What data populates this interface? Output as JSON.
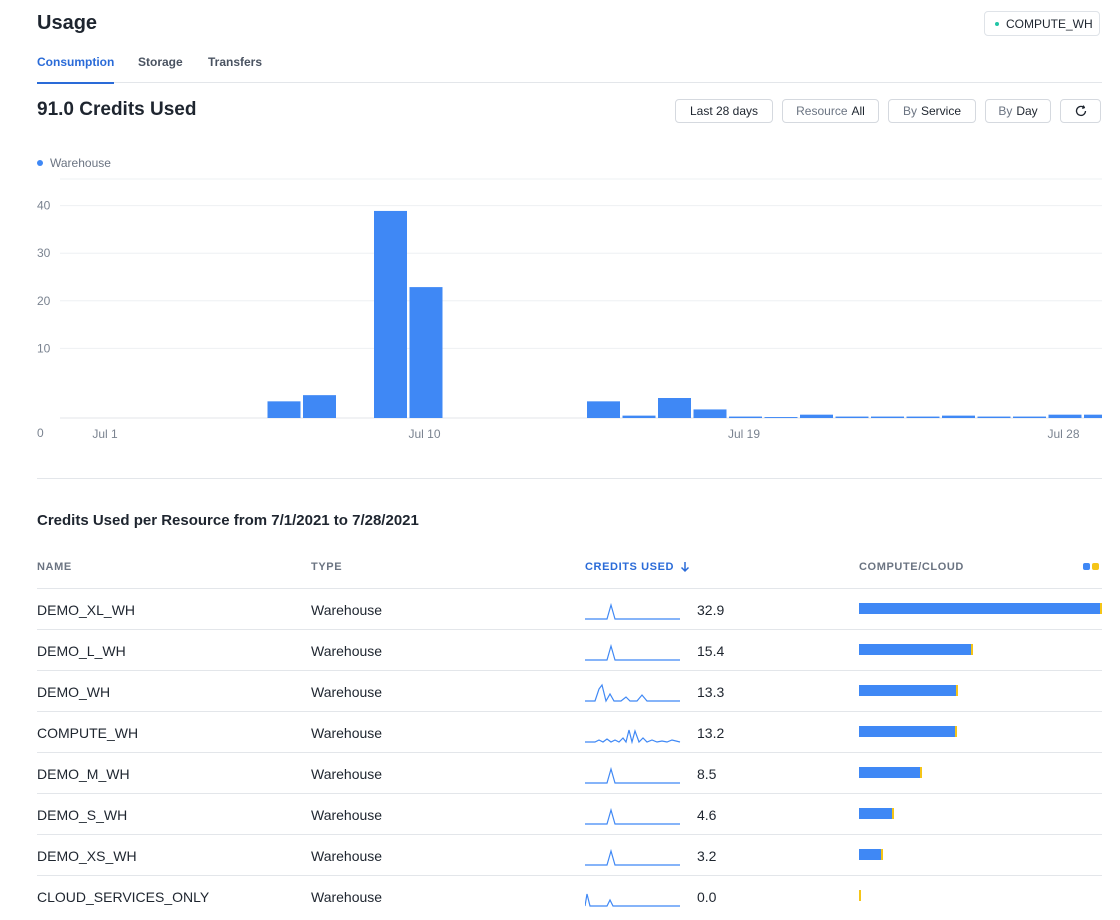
{
  "header": {
    "title": "Usage",
    "warehouse_badge": "COMPUTE_WH"
  },
  "tabs": [
    {
      "label": "Consumption",
      "active": true
    },
    {
      "label": "Storage",
      "active": false
    },
    {
      "label": "Transfers",
      "active": false
    }
  ],
  "summary": {
    "credits_title": "91.0 Credits Used"
  },
  "filters": {
    "date_range": "Last 28 days",
    "resource_label": "Resource",
    "resource_value": "All",
    "group_label": "By",
    "group_value": "Service",
    "interval_label": "By",
    "interval_value": "Day"
  },
  "colors": {
    "accent": "#2a6bd8",
    "bar": "#3f88f5",
    "cloud": "#f5c518",
    "badge_dot": "#22c5a6"
  },
  "chart_data": {
    "type": "bar",
    "legend": [
      {
        "name": "Warehouse",
        "color": "#3f88f5"
      }
    ],
    "legend_placement": "top-left",
    "grid": true,
    "ylim": [
      0,
      50
    ],
    "y_ticks": [
      0,
      10,
      20,
      30,
      40,
      50
    ],
    "x_tick_labels": [
      {
        "label": "Jul 1",
        "index": 0
      },
      {
        "label": "Jul 10",
        "index": 9
      },
      {
        "label": "Jul 19",
        "index": 18
      },
      {
        "label": "Jul 28",
        "index": 27
      }
    ],
    "categories": [
      "Jul 1",
      "Jul 2",
      "Jul 3",
      "Jul 4",
      "Jul 5",
      "Jul 6",
      "Jul 7",
      "Jul 8",
      "Jul 9",
      "Jul 10",
      "Jul 11",
      "Jul 12",
      "Jul 13",
      "Jul 14",
      "Jul 15",
      "Jul 16",
      "Jul 17",
      "Jul 18",
      "Jul 19",
      "Jul 20",
      "Jul 21",
      "Jul 22",
      "Jul 23",
      "Jul 24",
      "Jul 25",
      "Jul 26",
      "Jul 27",
      "Jul 28"
    ],
    "series": [
      {
        "values": [
          0,
          0,
          0,
          0,
          0,
          3.5,
          4.8,
          0,
          43.5,
          27.5,
          0,
          0,
          0,
          0,
          3.5,
          0.5,
          4.2,
          1.8,
          0.3,
          0.2,
          0.7,
          0.3,
          0.3,
          0.3,
          0.5,
          0.3,
          0.3,
          0.7,
          0.7,
          0.5
        ]
      }
    ]
  },
  "resource_table": {
    "title": "Credits Used per Resource from 7/1/2021 to 7/28/2021",
    "columns": {
      "name": "NAME",
      "type": "TYPE",
      "credits": "CREDITS USED",
      "compute_cloud": "COMPUTE/CLOUD"
    },
    "rows": [
      {
        "name": "DEMO_XL_WH",
        "type": "Warehouse",
        "credits": "32.9",
        "compute_fraction": 1.0,
        "spark": "single"
      },
      {
        "name": "DEMO_L_WH",
        "type": "Warehouse",
        "credits": "15.4",
        "compute_fraction": 0.468,
        "spark": "single"
      },
      {
        "name": "DEMO_WH",
        "type": "Warehouse",
        "credits": "13.3",
        "compute_fraction": 0.404,
        "spark": "multi"
      },
      {
        "name": "COMPUTE_WH",
        "type": "Warehouse",
        "credits": "13.2",
        "compute_fraction": 0.401,
        "spark": "noisy"
      },
      {
        "name": "DEMO_M_WH",
        "type": "Warehouse",
        "credits": "8.5",
        "compute_fraction": 0.258,
        "spark": "single"
      },
      {
        "name": "DEMO_S_WH",
        "type": "Warehouse",
        "credits": "4.6",
        "compute_fraction": 0.14,
        "spark": "single"
      },
      {
        "name": "DEMO_XS_WH",
        "type": "Warehouse",
        "credits": "3.2",
        "compute_fraction": 0.097,
        "spark": "single"
      },
      {
        "name": "CLOUD_SERVICES_ONLY",
        "type": "Warehouse",
        "credits": "0.0",
        "compute_fraction": 0.0,
        "spark": "early"
      }
    ]
  }
}
